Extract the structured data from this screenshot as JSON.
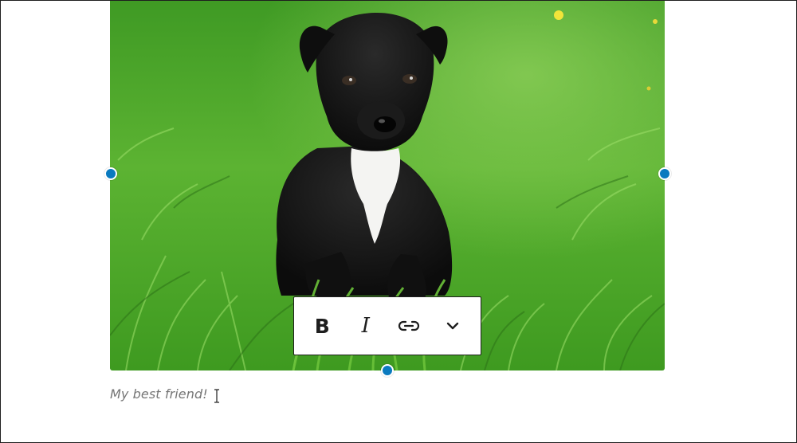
{
  "image": {
    "subject": "black puppy sitting in green grass",
    "colors": {
      "grass_dark": "#2f7d1c",
      "grass_mid": "#4aa526",
      "grass_light": "#8fd05a",
      "puppy": "#141414",
      "chest": "#f4f4f2",
      "handle": "#0a7abf"
    }
  },
  "toolbar": {
    "bold_label": "B",
    "italic_label": "I",
    "link_icon": "link-icon",
    "more_icon": "chevron-down-icon"
  },
  "caption": {
    "text": "My best friend!"
  }
}
